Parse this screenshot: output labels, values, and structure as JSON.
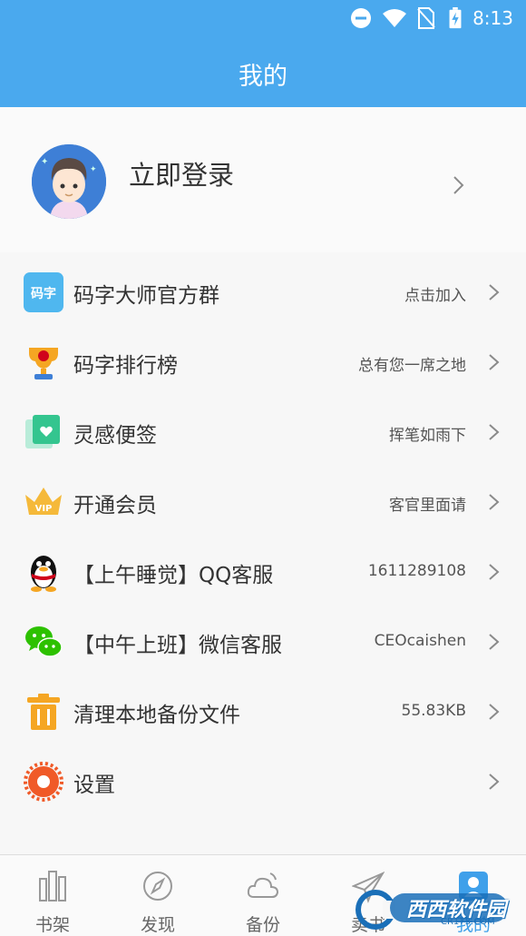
{
  "status_bar": {
    "time": "8:13"
  },
  "app_bar": {
    "title": "我的"
  },
  "profile": {
    "login_label": "立即登录"
  },
  "menu": [
    {
      "label": "码字大师官方群",
      "value": "点击加入",
      "icon": "group-qr-icon",
      "icon_text": "码字"
    },
    {
      "label": "码字排行榜",
      "value": "总有您一席之地",
      "icon": "trophy-icon"
    },
    {
      "label": "灵感便签",
      "value": "挥笔如雨下",
      "icon": "sticky-note-icon"
    },
    {
      "label": "开通会员",
      "value": "客官里面请",
      "icon": "vip-crown-icon",
      "icon_text": "VIP"
    },
    {
      "label": "【上午睡觉】QQ客服",
      "value": "1611289108",
      "icon": "qq-penguin-icon"
    },
    {
      "label": "【中午上班】微信客服",
      "value": "CEOcaishen",
      "icon": "wechat-icon"
    },
    {
      "label": "清理本地备份文件",
      "value": "55.83KB",
      "icon": "trash-icon"
    },
    {
      "label": "设置",
      "value": "",
      "icon": "settings-gear-icon"
    }
  ],
  "tabs": [
    {
      "label": "书架",
      "icon": "bookshelf-icon",
      "active": false
    },
    {
      "label": "发现",
      "icon": "compass-icon",
      "active": false
    },
    {
      "label": "备份",
      "icon": "cloud-icon",
      "active": false
    },
    {
      "label": "卖书",
      "icon": "paper-plane-icon",
      "active": false
    },
    {
      "label": "我的",
      "icon": "user-icon",
      "active": true
    }
  ],
  "watermark": {
    "text": "西西软件园",
    "sub": "CR173.COM"
  },
  "colors": {
    "primary": "#4aa9ee",
    "text": "#333333",
    "chevron": "#8a8a8a"
  }
}
